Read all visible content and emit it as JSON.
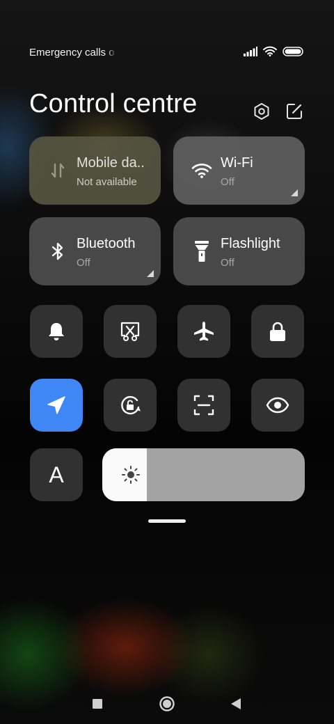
{
  "status_bar": {
    "text": "Emergency calls o",
    "icons": [
      "signal-icon",
      "wifi-icon",
      "battery-icon"
    ]
  },
  "header": {
    "title": "Control centre",
    "buttons": [
      "settings-icon",
      "edit-icon"
    ]
  },
  "tiles": [
    {
      "label": "Mobile da..",
      "status": "Not available",
      "icon": "mobile-data-icon"
    },
    {
      "label": "Wi-Fi",
      "status": "Off",
      "icon": "wifi-icon"
    },
    {
      "label": "Bluetooth",
      "status": "Off",
      "icon": "bluetooth-icon"
    },
    {
      "label": "Flashlight",
      "status": "Off",
      "icon": "flashlight-icon"
    }
  ],
  "toggles": [
    {
      "icon": "bell-icon",
      "active": false
    },
    {
      "icon": "screenshot-icon",
      "active": false
    },
    {
      "icon": "airplane-icon",
      "active": false
    },
    {
      "icon": "lock-icon",
      "active": false
    },
    {
      "icon": "location-icon",
      "active": true
    },
    {
      "icon": "rotation-lock-icon",
      "active": false
    },
    {
      "icon": "scanner-icon",
      "active": false
    },
    {
      "icon": "eye-icon",
      "active": false
    }
  ],
  "font_button": {
    "label": "A"
  },
  "brightness": {
    "level_percent": 22
  },
  "colors": {
    "accent": "#3e87f5",
    "tile_bg": "#4e4e4e",
    "toggle_bg": "#343434"
  },
  "nav_bar": [
    "recents-icon",
    "home-icon",
    "back-icon"
  ]
}
